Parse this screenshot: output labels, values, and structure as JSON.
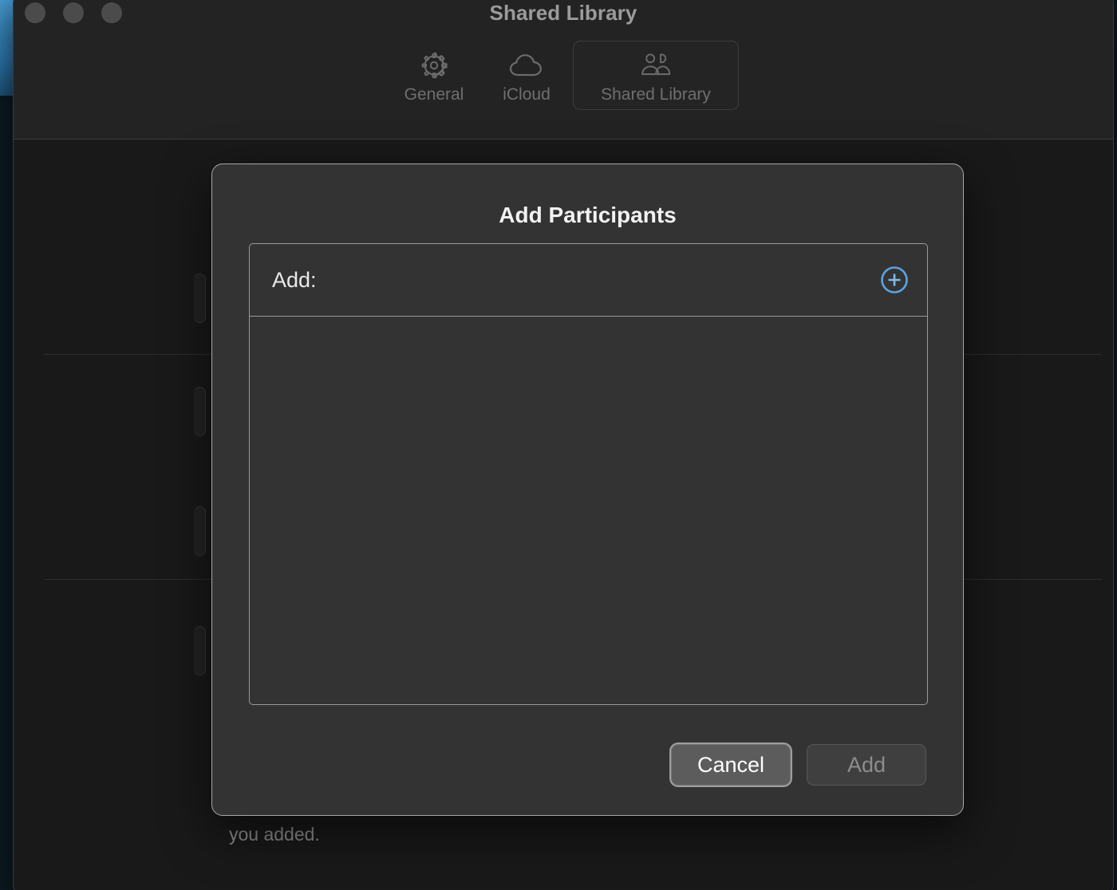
{
  "window": {
    "title": "Shared Library",
    "traffic_lights": [
      {
        "name": "close",
        "state": "inactive"
      },
      {
        "name": "minimize",
        "state": "inactive"
      },
      {
        "name": "zoom",
        "state": "inactive"
      }
    ]
  },
  "toolbar": {
    "tabs": [
      {
        "id": "general",
        "label": "General",
        "icon": "gear-icon",
        "selected": false
      },
      {
        "id": "icloud",
        "label": "iCloud",
        "icon": "cloud-icon",
        "selected": false
      },
      {
        "id": "shared-library",
        "label": "Shared Library",
        "icon": "people-icon",
        "selected": true
      }
    ]
  },
  "background": {
    "footnote": "you added."
  },
  "dialog": {
    "title": "Add Participants",
    "add_field": {
      "label": "Add:",
      "value": "",
      "placeholder": "",
      "plus_button_icon": "plus-circle-icon"
    },
    "participants": [],
    "buttons": [
      {
        "id": "cancel",
        "label": "Cancel",
        "style": "default",
        "enabled": true
      },
      {
        "id": "add",
        "label": "Add",
        "style": "disabled",
        "enabled": false
      }
    ]
  },
  "colors": {
    "accent_blue": "#5ba3e0",
    "sheet_background": "#333333",
    "window_background": "#1e1e1e",
    "content_background": "#191919",
    "title_text": "#9b9b9b",
    "tab_text": "#6f6f6f"
  }
}
